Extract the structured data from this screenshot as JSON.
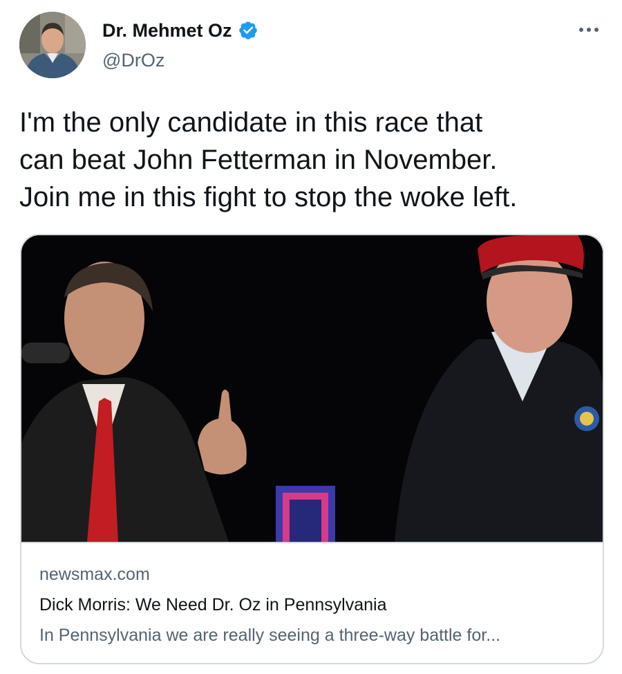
{
  "author": {
    "name": "Dr. Mehmet Oz",
    "handle": "@DrOz",
    "verified": true
  },
  "tweet": {
    "text": "I'm the only candidate in this race that\ncan beat John Fetterman in November.\nJoin me in this fight to stop the woke left."
  },
  "card": {
    "domain": "newsmax.com",
    "title": "Dick Morris: We Need Dr. Oz in Pennsylvania",
    "description": "In Pennsylvania we are really seeing a three-way battle for..."
  },
  "icons": {
    "more": "more-options-icon",
    "verified": "verified-badge-icon",
    "avatar": "profile-photo"
  },
  "colors": {
    "text_primary": "#0f1419",
    "text_secondary": "#536471",
    "verified_blue": "#1d9bf0",
    "border": "#cfd9de"
  }
}
